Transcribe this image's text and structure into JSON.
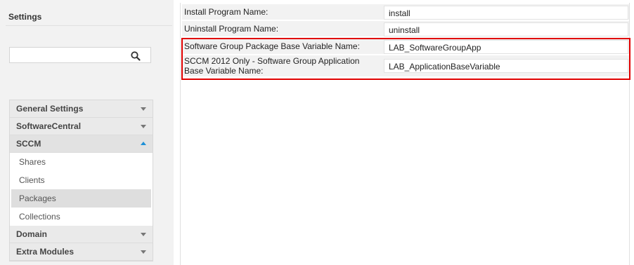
{
  "sidebar": {
    "title": "Settings",
    "search": {
      "value": "",
      "placeholder": ""
    },
    "sections": [
      {
        "label": "General Settings",
        "expanded": false
      },
      {
        "label": "SoftwareCentral",
        "expanded": false
      },
      {
        "label": "SCCM",
        "expanded": true,
        "items": [
          "Shares",
          "Clients",
          "Packages",
          "Collections"
        ],
        "selected": "Packages"
      },
      {
        "label": "Domain",
        "expanded": false
      },
      {
        "label": "Extra Modules",
        "expanded": false
      }
    ]
  },
  "properties": [
    {
      "label": "Install Program Name:",
      "value": "install"
    },
    {
      "label": "Uninstall Program Name:",
      "value": "uninstall"
    },
    {
      "label": "Software Group Package Base Variable Name:",
      "value": "LAB_SoftwareGroupApp"
    },
    {
      "label": "SCCM 2012 Only - Software Group Application Base Variable Name:",
      "value": "LAB_ApplicationBaseVariable"
    }
  ],
  "colors": {
    "highlight": "#e00000",
    "accent": "#1e90d6"
  }
}
